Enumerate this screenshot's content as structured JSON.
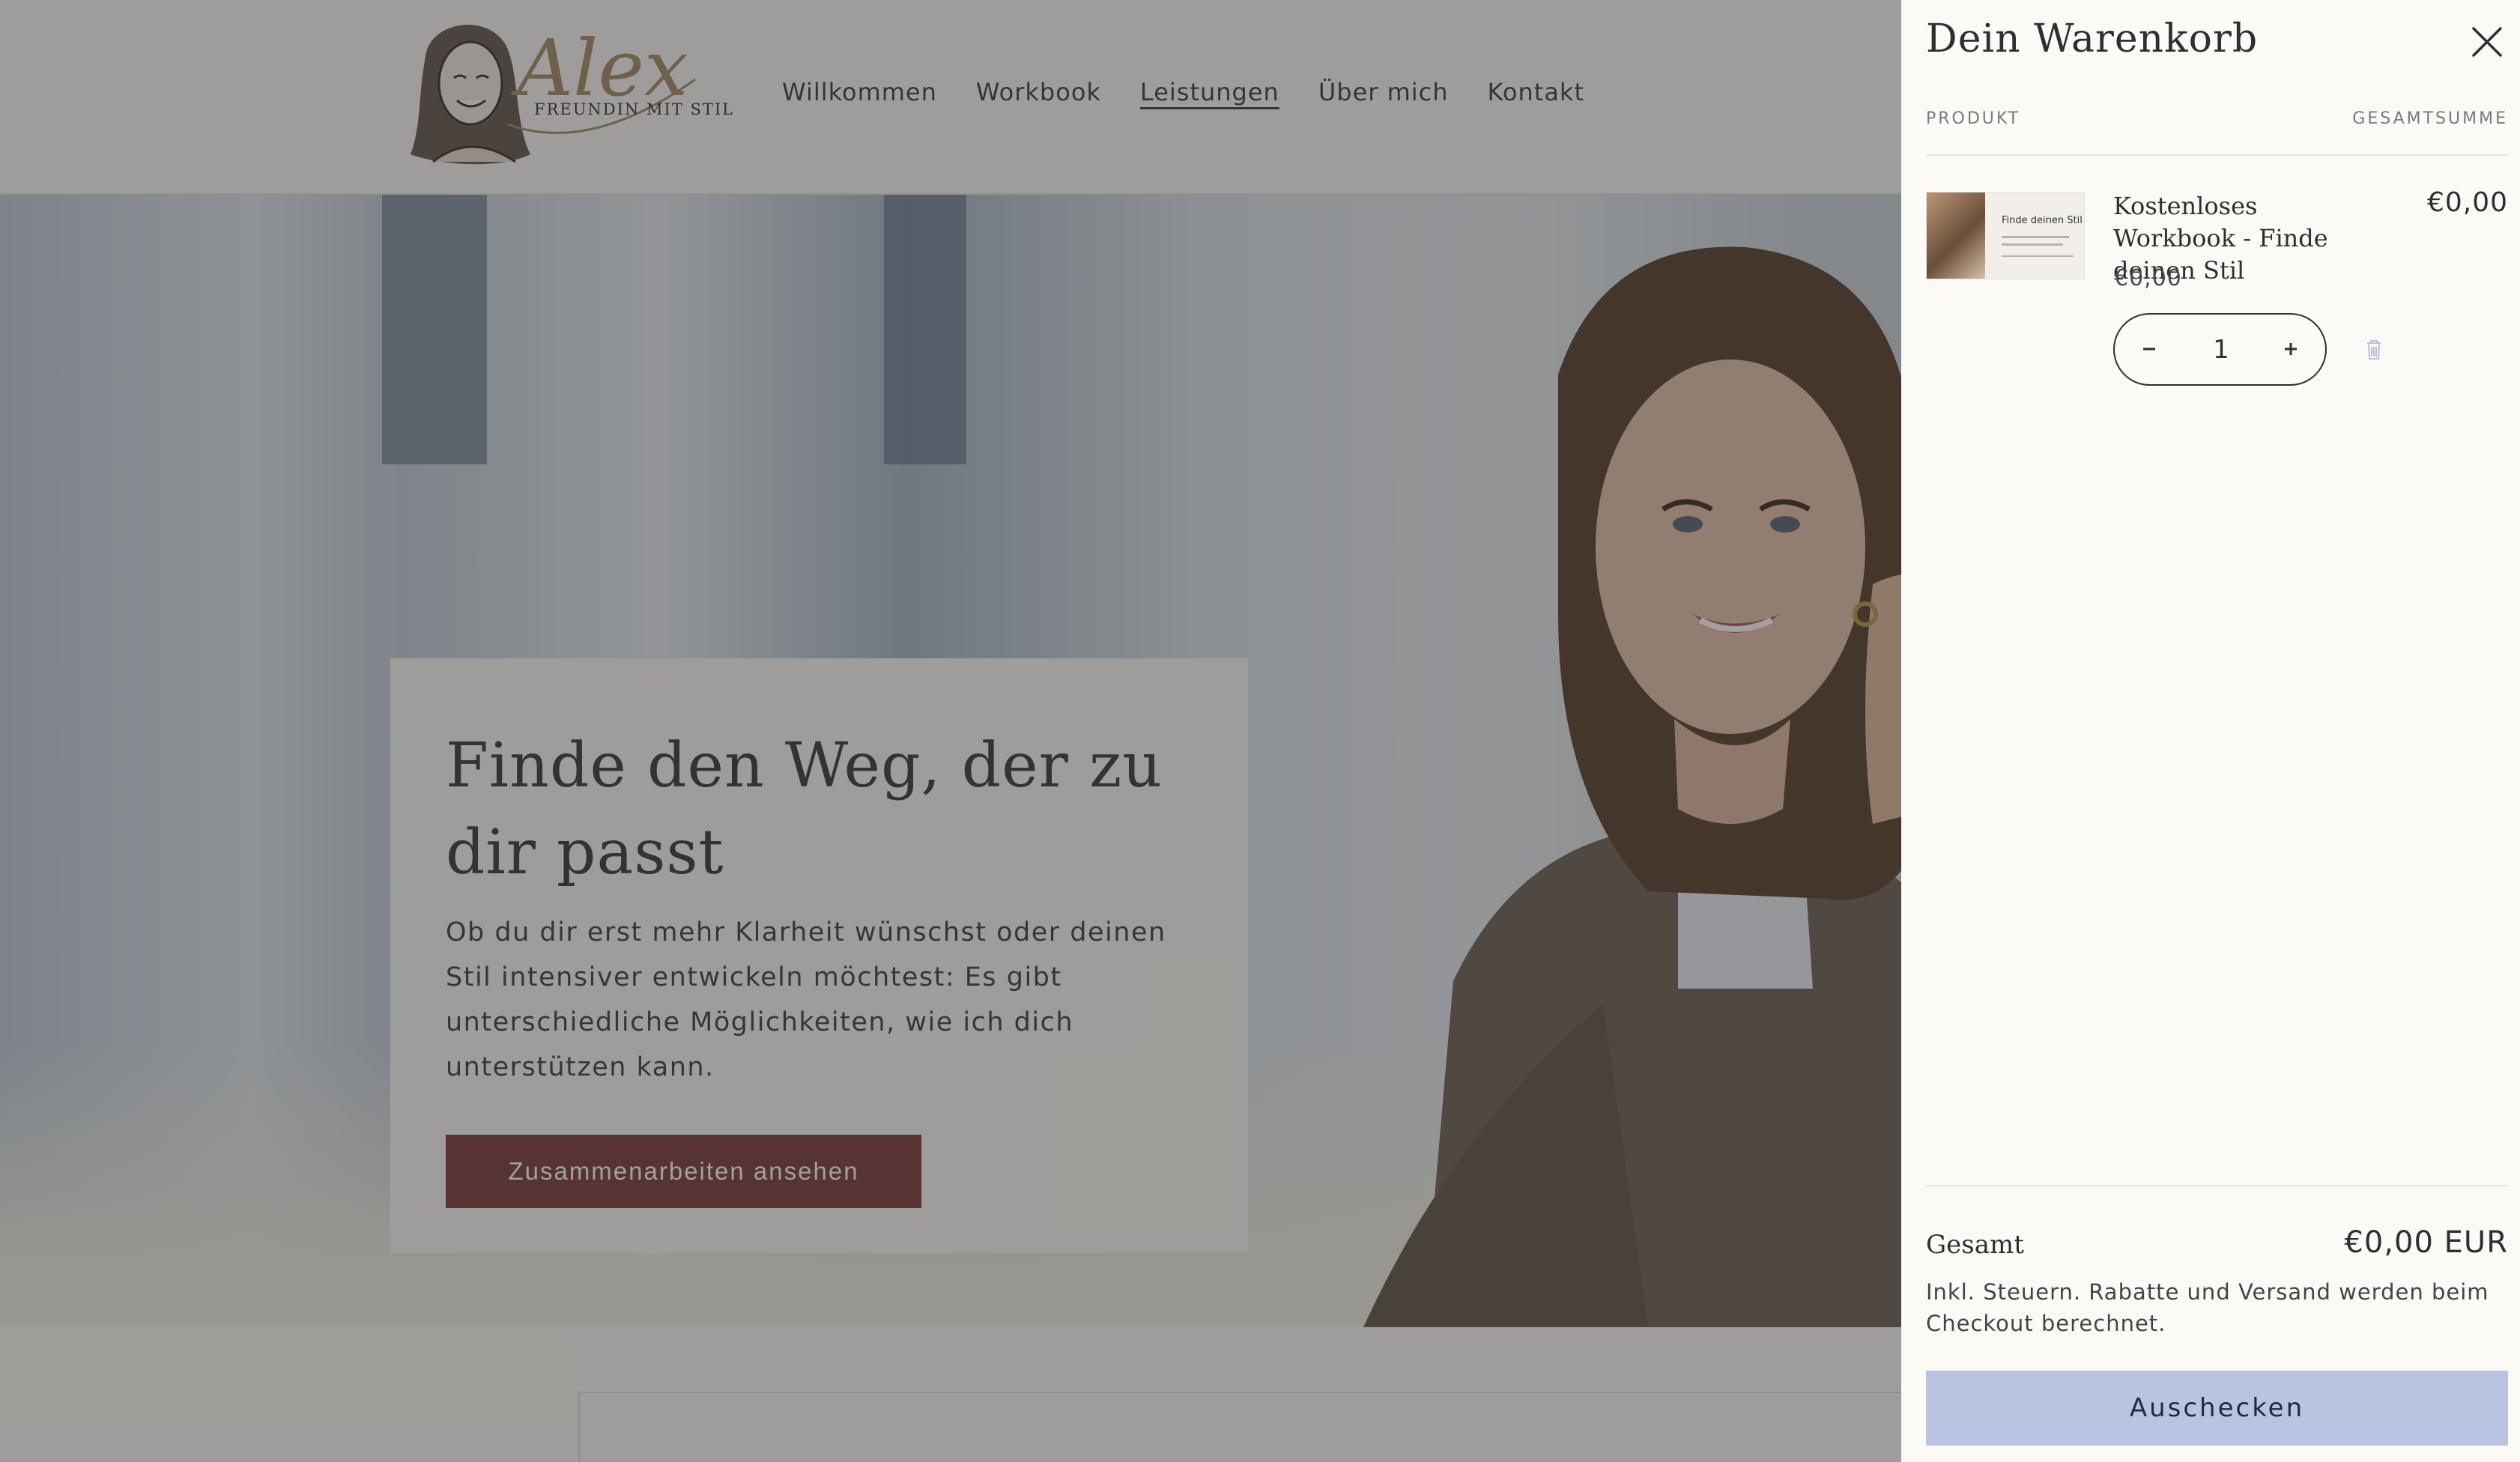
{
  "header": {
    "logo": {
      "name": "Alex",
      "tagline": "FREUNDIN MIT STIL"
    },
    "nav": [
      {
        "label": "Willkommen"
      },
      {
        "label": "Workbook"
      },
      {
        "label": "Leistungen",
        "active": true
      },
      {
        "label": "Über mich"
      },
      {
        "label": "Kontakt"
      }
    ]
  },
  "hero": {
    "title": "Finde den Weg, der zu dir passt",
    "text": "Ob du dir erst mehr Klarheit wünschst oder deinen Stil intensiver entwickeln möchtest: Es gibt unterschiedliche Möglichkeiten, wie ich dich unterstützen kann.",
    "cta_label": "Zusammenarbeiten ansehen"
  },
  "cart": {
    "title": "Dein Warenkorb",
    "col_product": "PRODUKT",
    "col_total": "GESAMTSUMME",
    "items": [
      {
        "name": "Kostenloses Workbook - Finde deinen Stil",
        "price": "€0,00",
        "total": "€0,00",
        "quantity": "1",
        "thumb_title": "Finde deinen Stil"
      }
    ],
    "total_label": "Gesamt",
    "total_value": "€0,00 EUR",
    "tax_note": "Inkl. Steuern. Rabatte und Versand werden beim Checkout berechnet.",
    "checkout_label": "Auschecken"
  },
  "colors": {
    "accent_button": "#7b3b39",
    "checkout_button": "#b9c5e0",
    "logo_gold": "#a58a63"
  },
  "icons": [
    "close-icon",
    "minus-icon",
    "plus-icon",
    "trash-icon"
  ]
}
